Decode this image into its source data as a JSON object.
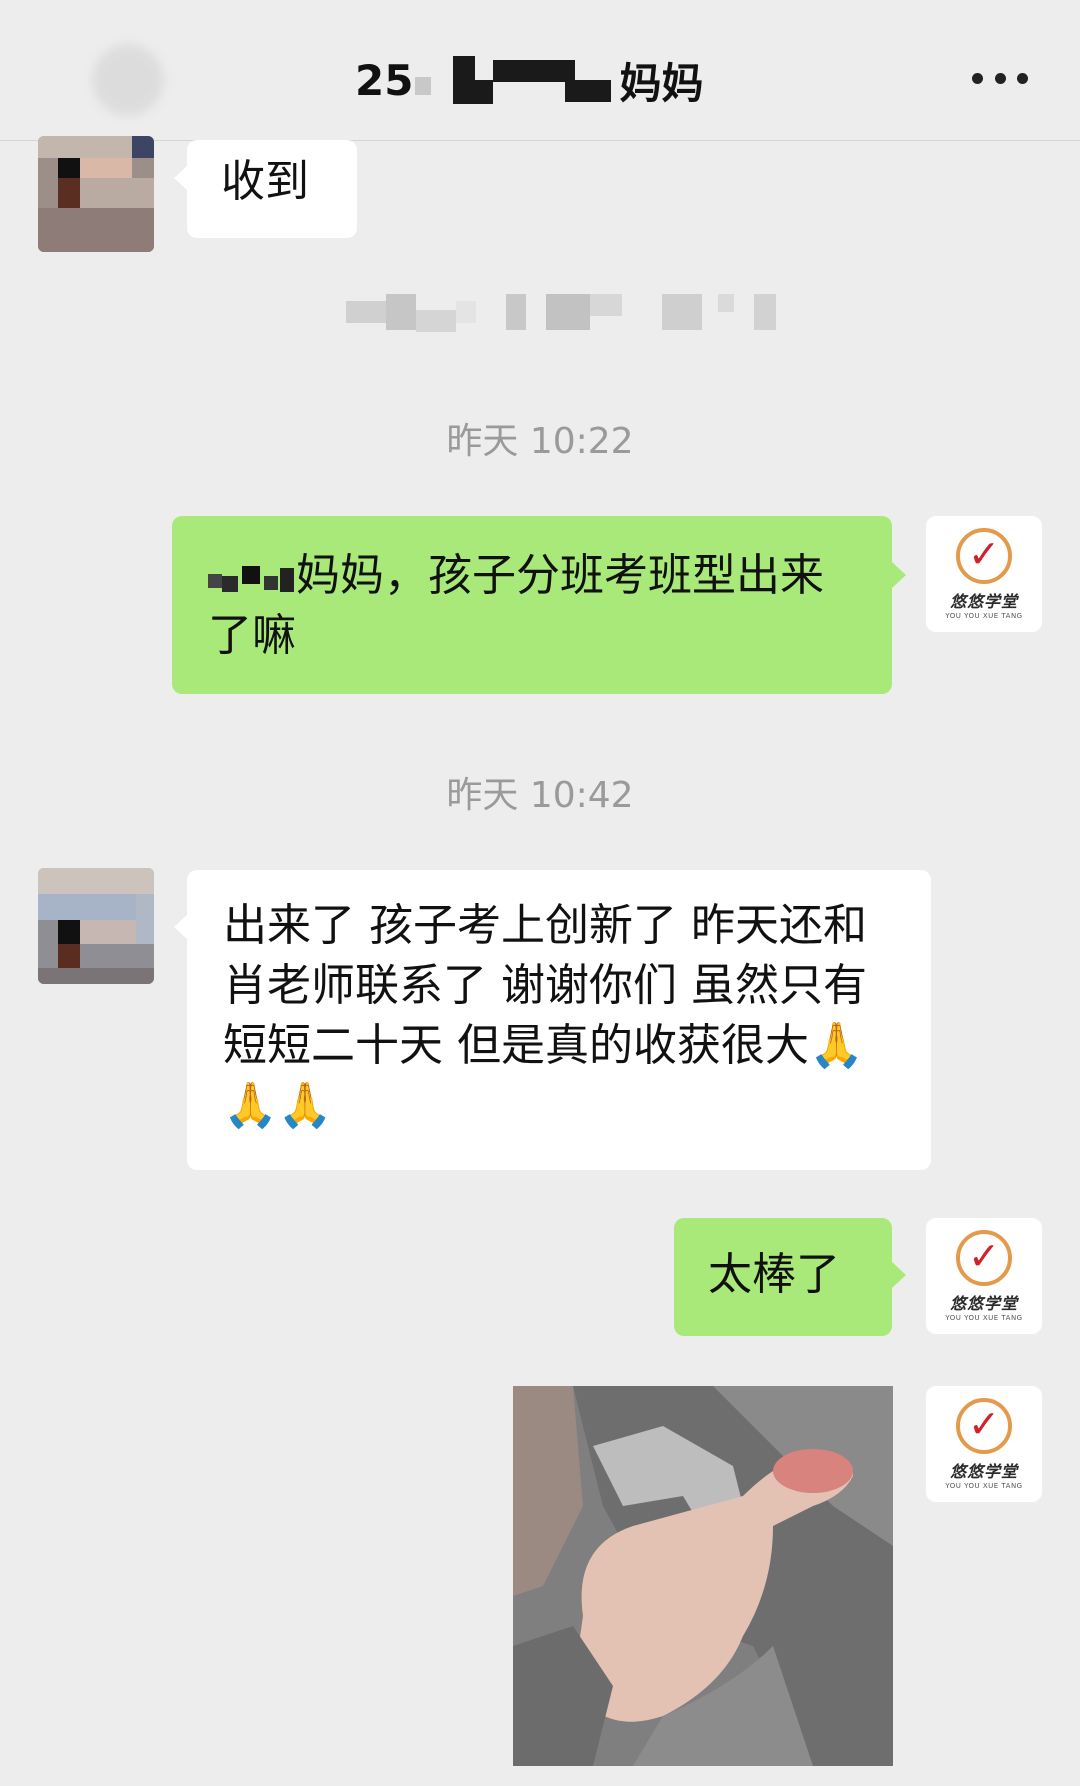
{
  "header": {
    "title_prefix": "25",
    "title_suffix": "妈妈",
    "more_icon": "more-dots-icon"
  },
  "messages": {
    "m1": {
      "text": "收到"
    },
    "t1": {
      "text": "昨天 10:22"
    },
    "m2": {
      "text": "妈妈，孩子分班考班型出来了嘛"
    },
    "t2": {
      "text": "昨天 10:42"
    },
    "m3": {
      "text": "出来了 孩子考上创新了 昨天还和肖老师联系了 谢谢你们 虽然只有短短二十天 但是真的收获很大🙏🙏🙏"
    },
    "m4": {
      "text": "太棒了"
    }
  },
  "brand": {
    "name": "悠悠学堂",
    "sub": "YOU YOU XUE TANG",
    "accent": "#e49a4b",
    "check_color": "#d0222a"
  },
  "colors": {
    "background": "#ededed",
    "bubble_self": "#a9e97a",
    "bubble_other": "#ffffff",
    "timestamp": "#9a9a9a"
  }
}
